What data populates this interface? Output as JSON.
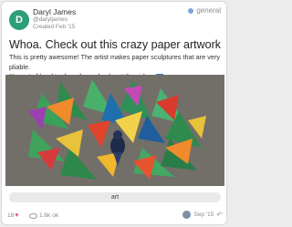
{
  "post": {
    "category": "general",
    "author": {
      "initial": "D",
      "name": "Daryl James",
      "handle": "@daryljames",
      "created": "Created Feb '15"
    },
    "title": "Whoa. Check out this crazy paper artwork",
    "body_line1": "This is pretty awesome! The artist makes paper sculptures that are very pliable.",
    "body_line2": "It's sort of hard to describe – check out the video.",
    "tag": "art",
    "footer": {
      "likes": "18",
      "views": "1.6k",
      "views_unit": "ok",
      "last_activity": "Sep '15"
    }
  },
  "colors": {
    "avatar": "#2e9e7a",
    "category_dot": "#7aa6d6",
    "like": "#e2556a",
    "video_icon": "#2a6fc9"
  },
  "icons": {
    "category": "category-dot-icon",
    "video": "video-play-icon",
    "like": "heart-icon",
    "views": "eye-icon",
    "reply": "reply-icon"
  }
}
